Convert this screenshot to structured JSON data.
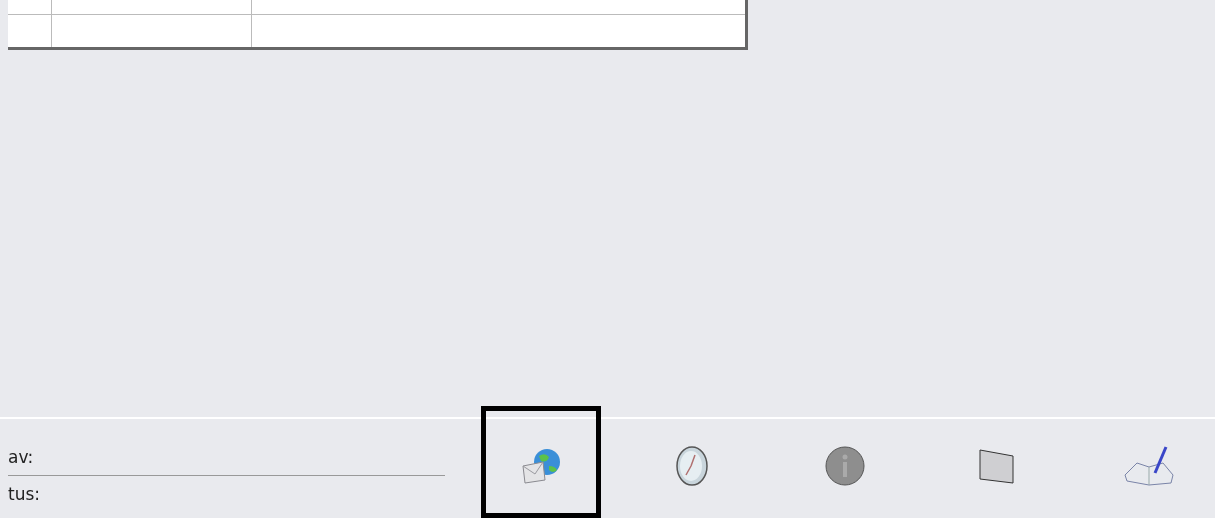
{
  "details": [
    {
      "label": "av:"
    },
    {
      "label": "tus:"
    }
  ],
  "toolbar": [
    {
      "selected": true
    },
    {
      "selected": false
    },
    {
      "selected": false
    },
    {
      "selected": false
    },
    {
      "selected": false
    }
  ]
}
